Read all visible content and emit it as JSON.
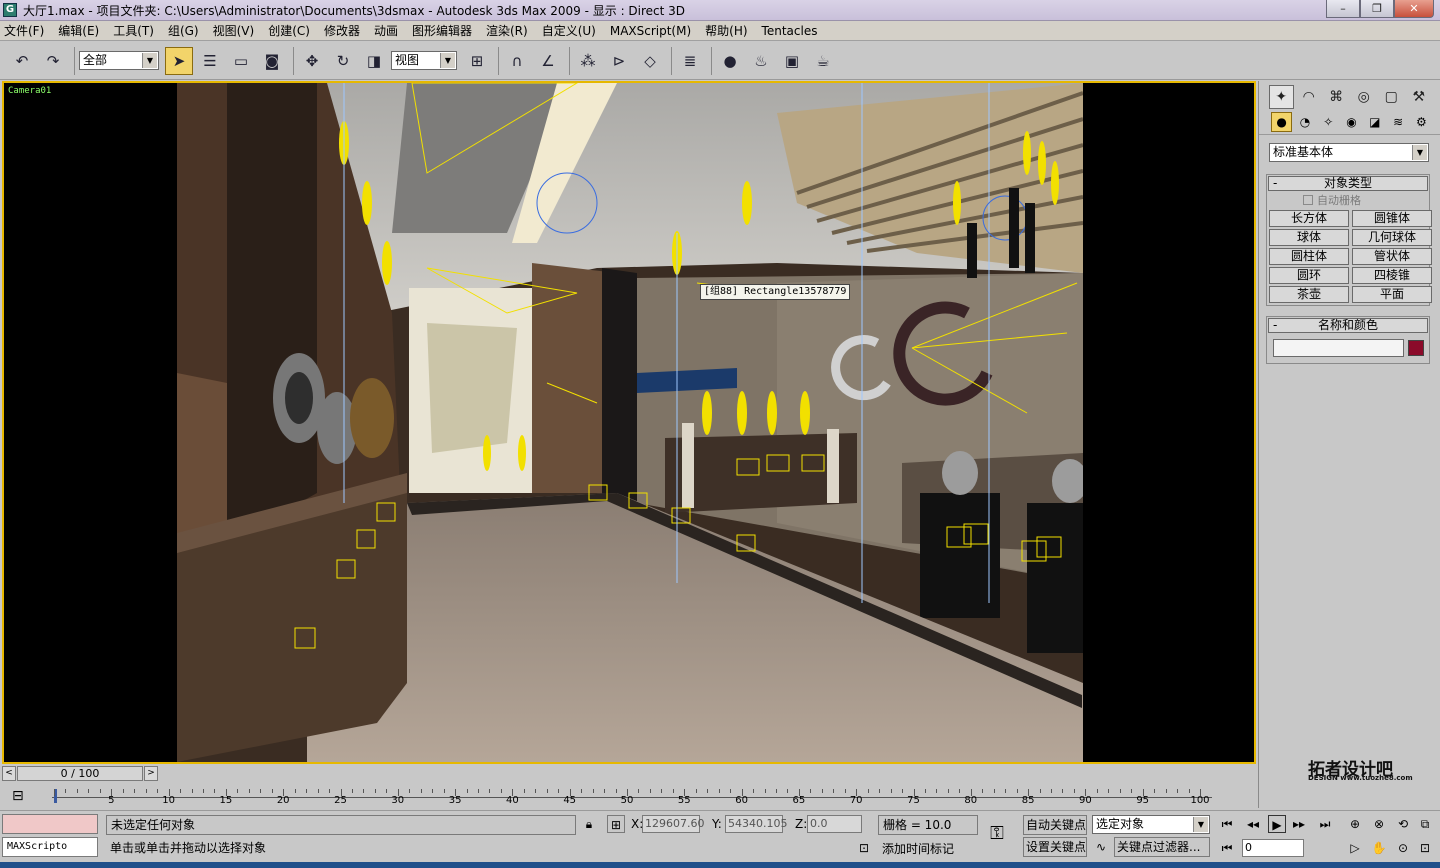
{
  "window": {
    "title": "大厅1.max    - 项目文件夹: C:\\Users\\Administrator\\Documents\\3dsmax    - Autodesk 3ds Max  2009    - 显示 : Direct 3D",
    "minimize": "–",
    "restore": "❐",
    "close": "✕"
  },
  "menu": [
    "文件(F)",
    "编辑(E)",
    "工具(T)",
    "组(G)",
    "视图(V)",
    "创建(C)",
    "修改器",
    "动画",
    "图形编辑器",
    "渲染(R)",
    "自定义(U)",
    "MAXScript(M)",
    "帮助(H)",
    "Tentacles"
  ],
  "toolbar": {
    "selection_filter": "全部",
    "reference_coord": "视图"
  },
  "viewport": {
    "label": "Camera01",
    "tooltip": "[组88] Rectangle13578779"
  },
  "command_panel": {
    "category": "标准基本体",
    "object_type_title": "对象类型",
    "autogrid": "自动栅格",
    "buttons": [
      "长方体",
      "圆锥体",
      "球体",
      "几何球体",
      "圆柱体",
      "管状体",
      "圆环",
      "四棱锥",
      "茶壶",
      "平面"
    ],
    "name_color_title": "名称和颜色",
    "color": "#8b0a2a"
  },
  "logo": {
    "text": "拓者设计吧",
    "sub": "DESIGN www.tuozhe8.com"
  },
  "time": {
    "frame_display": "0 / 100",
    "ticks": [
      5,
      10,
      15,
      20,
      25,
      30,
      35,
      40,
      45,
      50,
      55,
      60,
      65,
      70,
      75,
      80,
      85,
      90,
      95,
      100
    ]
  },
  "status": {
    "maxscript": "MAXScripto",
    "selection": "未选定任何对象",
    "prompt": "单击或单击并拖动以选择对象",
    "x_label": "X:",
    "x": "129607.60",
    "y_label": "Y:",
    "y": "54340.105",
    "z_label": "Z:",
    "z": "0.0",
    "grid": "栅格 = 10.0",
    "auto_key": "自动关键点",
    "set_key": "设置关键点",
    "selected_obj": "选定对象",
    "key_filters": "关键点过滤器...",
    "add_time_tag": "添加时间标记",
    "current_frame": "0"
  }
}
